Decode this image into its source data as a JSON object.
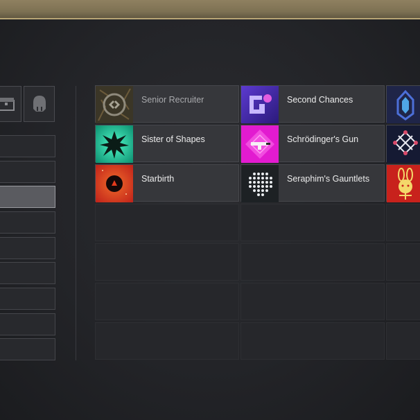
{
  "header": {
    "bar_color": "#7d7153"
  },
  "left_panel": {
    "icon_buttons": [
      {
        "icon": "chest-icon"
      },
      {
        "icon": "ghost-shell-icon"
      }
    ],
    "category_rows": 9,
    "selected_index": 2
  },
  "items": [
    {
      "name": "Senior Recruiter",
      "icon": "senior-recruiter-emblem-icon",
      "dimmed": true
    },
    {
      "name": "Second Chances",
      "icon": "second-chances-emblem-icon",
      "dimmed": false
    },
    {
      "name": "",
      "icon": "blue-crest-emblem-icon",
      "dimmed": false
    },
    {
      "name": "Sister of Shapes",
      "icon": "sister-of-shapes-emblem-icon",
      "dimmed": false
    },
    {
      "name": "Schrödinger's Gun",
      "icon": "schrodingers-gun-emblem-icon",
      "dimmed": false
    },
    {
      "name": "",
      "icon": "geometric-node-emblem-icon",
      "dimmed": false
    },
    {
      "name": "Starbirth",
      "icon": "starbirth-emblem-icon",
      "dimmed": false
    },
    {
      "name": "Seraphim's Gauntlets",
      "icon": "seraphims-gauntlets-emblem-icon",
      "dimmed": false
    },
    {
      "name": "",
      "icon": "rabbit-emblem-icon",
      "dimmed": false
    }
  ]
}
